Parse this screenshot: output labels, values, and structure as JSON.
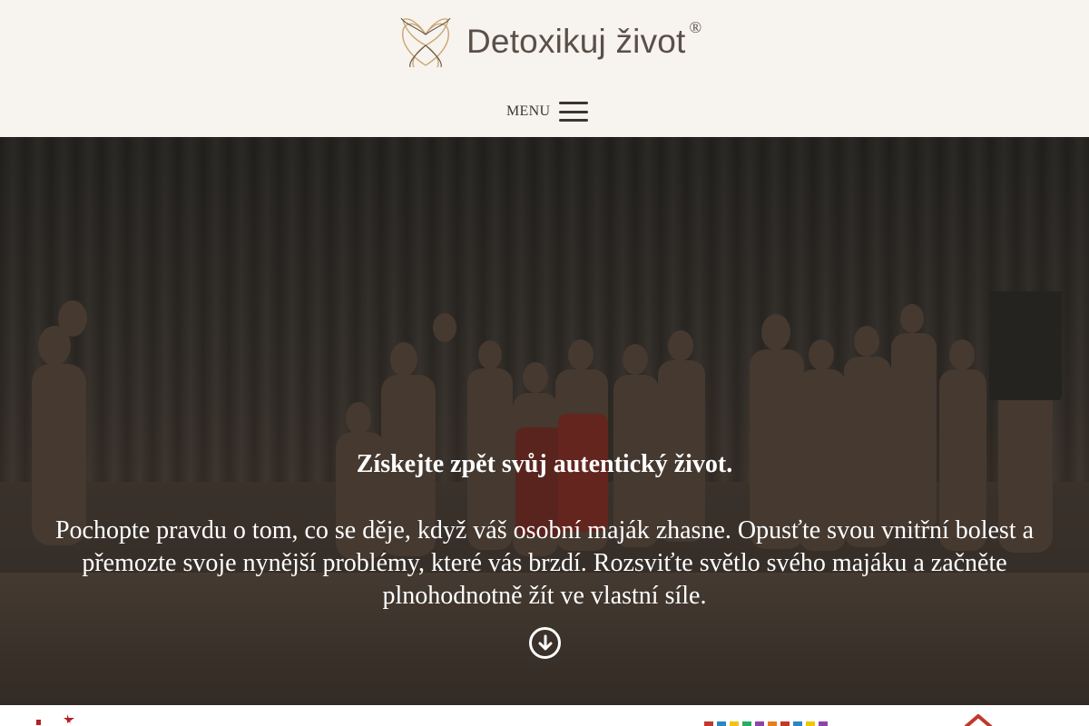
{
  "header": {
    "logo_text": "Detoxikuj život",
    "logo_reg": "®",
    "menu_label": "MENU",
    "colors": {
      "background": "#f7f3ee",
      "logo_gold": "#c9a36b",
      "text": "#5a5048"
    }
  },
  "hero": {
    "title": "Získejte zpět svůj autentický život.",
    "text": "Pochopte pravdu o tom, co se děje, když váš osobní maják zhasne. Opusťte svou vnitřní bolest a přemozte svoje nynější problémy, které vás brzdí. Rozsviťte světlo svého majáku a začněte plnohodnotně žít ve vlastní síle.",
    "scroll_icon": "arrow-down-circle-icon"
  },
  "partners": {
    "logos": [
      "partner-logo-1",
      "partner-logo-2",
      "partner-logo-3"
    ]
  }
}
